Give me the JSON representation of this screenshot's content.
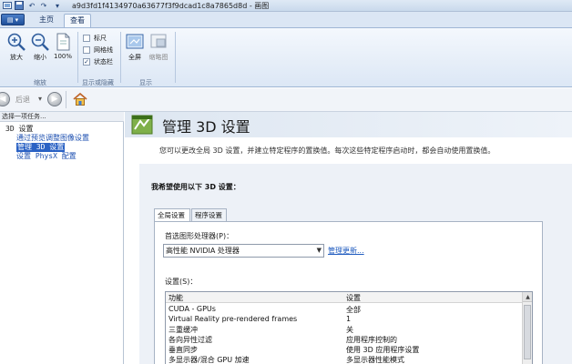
{
  "titlebar": {
    "title": "a9d3fd1f4134970a63677f3f9dcad1c8a7865d8d - 画图"
  },
  "ribbon": {
    "tabs": [
      {
        "label": "主页"
      },
      {
        "label": "查看"
      }
    ],
    "zoom_group": {
      "buttons": [
        {
          "label": "放大",
          "icon": "zoom-in-icon"
        },
        {
          "label": "缩小",
          "icon": "zoom-out-icon"
        },
        {
          "label": "100%",
          "icon": "actual-size-icon"
        }
      ],
      "group_label": "缩放"
    },
    "show_group": {
      "checkboxes": [
        {
          "label": "标尺",
          "checked": false
        },
        {
          "label": "网格线",
          "checked": false
        },
        {
          "label": "状态栏",
          "checked": true
        }
      ],
      "group_label": "显示或隐藏"
    },
    "display_group": {
      "buttons": [
        {
          "label": "全屏",
          "icon": "fullscreen-icon"
        },
        {
          "label": "缩略图",
          "icon": "thumbnail-icon"
        }
      ],
      "group_label": "显示"
    }
  },
  "nav": {
    "back_label": "后退"
  },
  "left_pane": {
    "header": "选择一项任务...",
    "tree": [
      {
        "label": "3D 设置",
        "level": 0
      },
      {
        "label": "通过预览调整图像设置",
        "level": 1
      },
      {
        "label": "管理 3D 设置",
        "level": 1,
        "selected": true
      },
      {
        "label": "设置 PhysX 配置",
        "level": 1
      }
    ]
  },
  "main": {
    "title": "管理 3D 设置",
    "description": "您可以更改全局 3D 设置，并建立特定程序的置换值。每次这些特定程序启动时，都会自动使用置换值。",
    "section_title": "我希望使用以下 3D 设置：",
    "tabs": [
      {
        "label": "全局设置"
      },
      {
        "label": "程序设置"
      }
    ],
    "preferred_gpu_label": "首选图形处理器(P)：",
    "preferred_gpu_value": "高性能 NVIDIA 处理器",
    "manage_link": "管理更新...",
    "settings_label": "设置(S)：",
    "settings_table": {
      "columns": [
        "功能",
        "设置"
      ],
      "rows": [
        [
          "CUDA - GPUs",
          "全部"
        ],
        [
          "Virtual Reality pre-rendered frames",
          "1"
        ],
        [
          "三重缓冲",
          "关"
        ],
        [
          "各向异性过滤",
          "应用程序控制的"
        ],
        [
          "垂直同步",
          "使用 3D 应用程序设置"
        ],
        [
          "多显示器/混合 GPU 加速",
          "多显示器性能模式"
        ]
      ]
    }
  }
}
